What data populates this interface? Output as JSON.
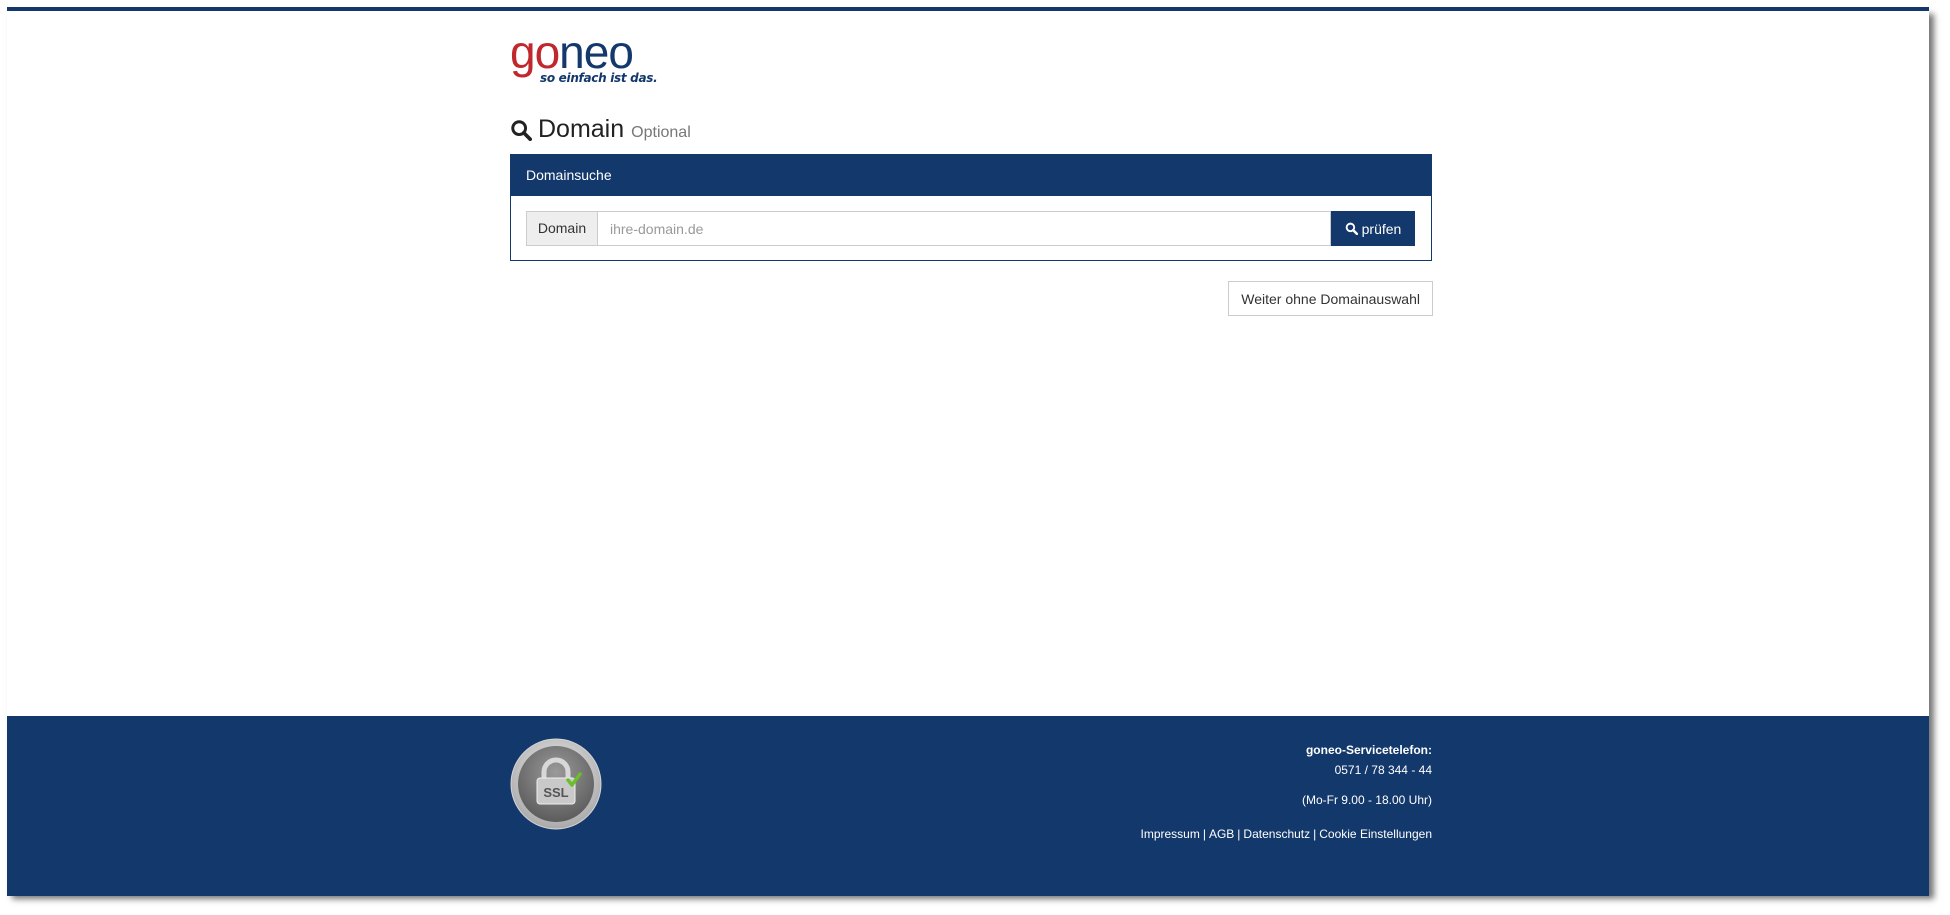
{
  "brand": {
    "logo_go": "go",
    "logo_neo": "neo",
    "slogan": "so einfach ist das.",
    "colors": {
      "primary": "#13386b",
      "logo_red": "#c0282d"
    }
  },
  "heading": {
    "icon": "search-icon",
    "title": "Domain",
    "subtitle": "Optional"
  },
  "panel": {
    "title": "Domainsuche",
    "addon_label": "Domain",
    "input_placeholder": "ihre-domain.de",
    "input_value": "",
    "check_button": "prüfen"
  },
  "skip_button": "Weiter ohne Domainauswahl",
  "footer": {
    "ssl_badge": "SSL",
    "service_label": "goneo-Servicetelefon:",
    "phone": "0571 / 78 344 - 44",
    "hours": "(Mo-Fr 9.00 - 18.00 Uhr)",
    "links": {
      "impressum": "Impressum",
      "agb": "AGB",
      "datenschutz": "Datenschutz",
      "cookies": "Cookie Einstellungen"
    }
  }
}
